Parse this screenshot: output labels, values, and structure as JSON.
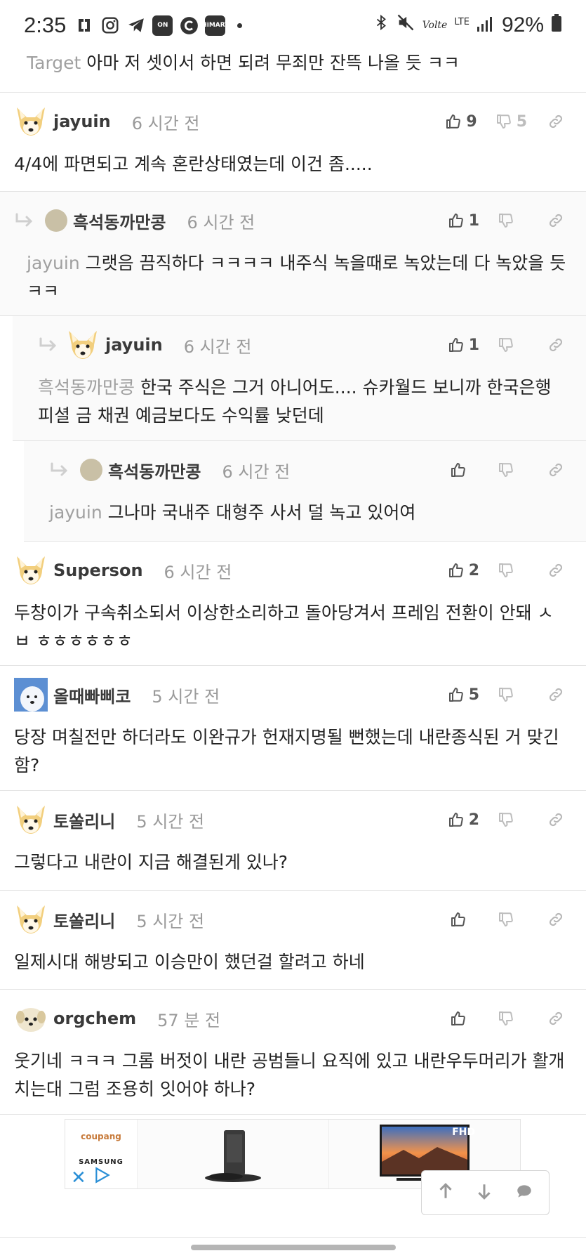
{
  "status_bar": {
    "time": "2:35",
    "battery": "92%",
    "network": "LTE",
    "volte": "Volte",
    "left_icons": [
      "sim-icon",
      "instagram-icon",
      "telegram-icon",
      "on-app-icon",
      "c-app-icon",
      "himart-app-icon",
      "dot-icon"
    ],
    "right_icons": [
      "bluetooth-icon",
      "mute-icon",
      "volte-icon",
      "lte-icon",
      "signal-icon",
      "battery-icon"
    ]
  },
  "top_fragment": {
    "mention": "Target",
    "text": "아마 저 셋이서 하면 되려 무죄만 잔뜩 나올 듯 ㅋㅋ"
  },
  "comments": [
    {
      "user": "jayuin",
      "time": "6 시간 전",
      "likes": "9",
      "dislikes": "5",
      "mention": "",
      "text": "4/4에 파면되고 계속 혼란상태였는데 이건 좀.....",
      "depth": 0,
      "avatar": "dog"
    },
    {
      "user": "흑석동까만콩",
      "time": "6 시간 전",
      "likes": "1",
      "dislikes": "",
      "mention": "jayuin",
      "text": "그랫음 끔직하다 ㅋㅋㅋㅋ 내주식 녹을때로 녹았는데 다 녹았을 듯 ㅋㅋ",
      "depth": 1,
      "avatar": "disc"
    },
    {
      "user": "jayuin",
      "time": "6 시간 전",
      "likes": "1",
      "dislikes": "",
      "mention": "흑석동까만콩",
      "text": "한국 주식은 그거 아니어도.... 슈카월드 보니까 한국은행 피셜 금 채권 예금보다도 수익률 낮던데",
      "depth": 2,
      "avatar": "dog"
    },
    {
      "user": "흑석동까만콩",
      "time": "6 시간 전",
      "likes": "",
      "dislikes": "",
      "mention": "jayuin",
      "text": "그나마 국내주 대형주 사서 덜 녹고 있어여",
      "depth": 3,
      "avatar": "disc"
    },
    {
      "user": "Superson",
      "time": "6 시간 전",
      "likes": "2",
      "dislikes": "",
      "mention": "",
      "text": "두창이가 구속취소되서 이상한소리하고 돌아당겨서 프레임 전환이 안돼 ㅅㅂ ㅎㅎㅎㅎㅎㅎ",
      "depth": 0,
      "avatar": "dog"
    },
    {
      "user": "올때빠삐코",
      "time": "5 시간 전",
      "likes": "5",
      "dislikes": "",
      "mention": "",
      "text": "당장 며칠전만 하더라도 이완규가 헌재지명될 뻔했는데 내란종식된 거 맞긴 함?",
      "depth": 0,
      "avatar": "photo"
    },
    {
      "user": "토쏠리니",
      "time": "5 시간 전",
      "likes": "2",
      "dislikes": "",
      "mention": "",
      "text": "그렇다고 내란이 지금 해결된게 있나?",
      "depth": 0,
      "avatar": "dog"
    },
    {
      "user": "토쏠리니",
      "time": "5 시간 전",
      "likes": "",
      "dislikes": "",
      "mention": "",
      "text": "일제시대 해방되고 이승만이 했던걸 할려고 하네",
      "depth": 0,
      "avatar": "dog"
    },
    {
      "user": "orgchem",
      "time": "57 분 전",
      "likes": "",
      "dislikes": "",
      "mention": "",
      "text": "웃기네 ㅋㅋㅋ 그롬 버젓이 내란 공범들니 요직에 있고 내란우두머리가 활개치는대 그럼 조용히 잇어야 하나?",
      "depth": 0,
      "avatar": "puppy"
    }
  ],
  "ad": {
    "brand_top": "coupang",
    "brand_bottom": "SAMSUNG",
    "tv_badge": "FHD",
    "close_symbol": "✕"
  },
  "float_nav": [
    "arrow-up-icon",
    "arrow-down-icon",
    "comment-icon"
  ],
  "colors": {
    "accent": "#2a8fd6",
    "muted": "#9a9a9a",
    "mention": "#a0a0a0"
  }
}
